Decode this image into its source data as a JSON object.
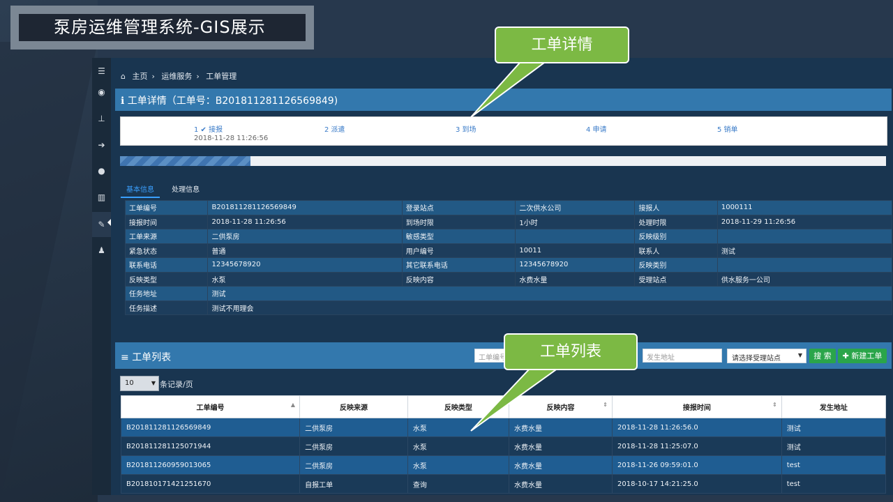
{
  "slide": {
    "title": "泵房运维管理系统-GIS展示"
  },
  "breadcrumb": {
    "items": [
      "主页",
      "运维服务",
      "工单管理"
    ]
  },
  "detail_panel": {
    "title": "工单详情（工单号：B201811281126569849)"
  },
  "steps": [
    {
      "label": "1 ✔ 接报",
      "date": "2018-11-28 11:26:56"
    },
    {
      "label": "2 派遣",
      "date": ""
    },
    {
      "label": "3 到场",
      "date": ""
    },
    {
      "label": "4 申请",
      "date": ""
    },
    {
      "label": "5 销单",
      "date": ""
    }
  ],
  "progress": {
    "fraction": 0.17
  },
  "tabs": [
    "基本信息",
    "处理信息"
  ],
  "basic_info": [
    [
      "工单编号",
      "B201811281126569849",
      "登录站点",
      "二次供水公司",
      "接报人",
      "1000111"
    ],
    [
      "接报时间",
      "2018-11-28 11:26:56",
      "到场时限",
      "1小时",
      "处理时限",
      "2018-11-29 11:26:56"
    ],
    [
      "工单来源",
      "二供泵房",
      "敏感类型",
      "",
      "反映级别",
      ""
    ],
    [
      "紧急状态",
      "普通",
      "用户编号",
      "10011",
      "联系人",
      "测试"
    ],
    [
      "联系电话",
      "12345678920",
      "其它联系电话",
      "12345678920",
      "反映类别",
      ""
    ],
    [
      "反映类型",
      "水泵",
      "反映内容",
      "水费水量",
      "受理站点",
      "供水服务一公司"
    ],
    [
      "任务地址",
      "测试",
      "",
      "",
      "",
      ""
    ],
    [
      "任务描述",
      "测试不用理会",
      "",
      "",
      "",
      ""
    ]
  ],
  "list_panel": {
    "title": "工单列表",
    "search_order_placeholder": "工单编号",
    "address_placeholder": "发生地址",
    "station_select": "请选择受理站点",
    "search_button": "搜 索",
    "new_button": "✚ 新建工单",
    "per_page_value": "10",
    "per_page_label": "条记录/页"
  },
  "table": {
    "columns": [
      "工单编号",
      "反映来源",
      "反映类型",
      "反映内容",
      "接报时间",
      "发生地址"
    ],
    "rows": [
      [
        "B201811281126569849",
        "二供泵房",
        "水泵",
        "水费水量",
        "2018-11-28 11:26:56.0",
        "测试"
      ],
      [
        "B201811281125071944",
        "二供泵房",
        "水泵",
        "水费水量",
        "2018-11-28 11:25:07.0",
        "测试"
      ],
      [
        "B201811260959013065",
        "二供泵房",
        "水泵",
        "水费水量",
        "2018-11-26 09:59:01.0",
        "test"
      ],
      [
        "B201810171421251670",
        "自报工单",
        "查询",
        "水费水量",
        "2018-10-17 14:21:25.0",
        "test"
      ]
    ]
  },
  "callouts": {
    "detail": "工单详情",
    "list": "工单列表"
  },
  "sidebar": {
    "icons": [
      "menu-icon",
      "globe-icon",
      "sitemap-icon",
      "sign-in-icon",
      "water-drop-icon",
      "bar-chart-icon",
      "wrench-icon",
      "user-icon"
    ]
  },
  "colors": {
    "accent": "#3378ad",
    "callout": "#7cb944",
    "button": "#2aa54a"
  }
}
